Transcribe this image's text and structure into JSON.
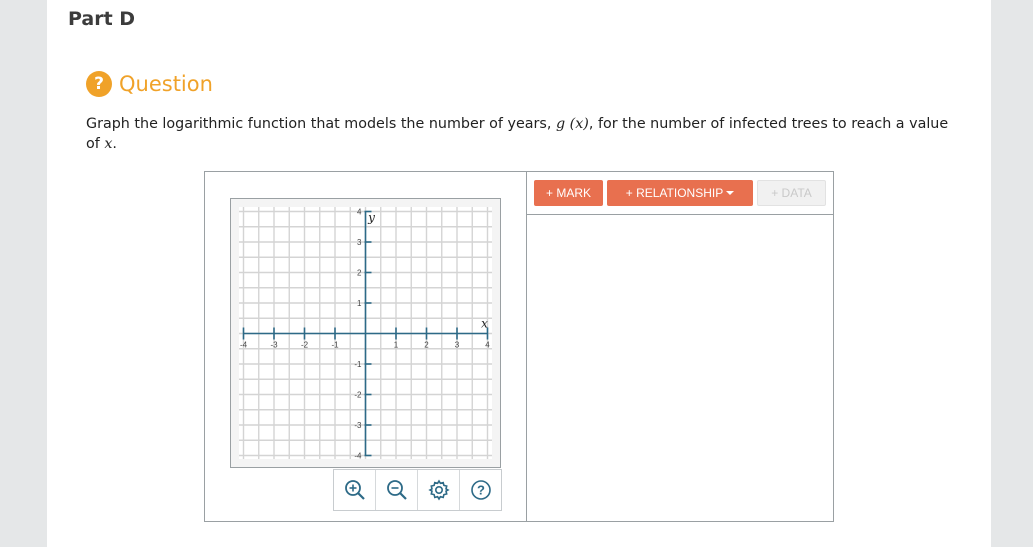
{
  "part_title": "Part D",
  "question": {
    "icon": "?",
    "label": "Question",
    "prompt_before": "Graph the logarithmic function that models the number of years,",
    "prompt_func": "g (x)",
    "prompt_after": ", for the number of infected trees to reach a value of",
    "prompt_var": "x",
    "prompt_end": "."
  },
  "toolbar": {
    "mark_label": "+ MARK",
    "relationship_label": "+ RELATIONSHIP",
    "data_label": "+ DATA"
  },
  "graph": {
    "x_axis_label": "x",
    "y_axis_label": "y",
    "xlim": [
      -4,
      4
    ],
    "ylim": [
      -4,
      4
    ],
    "x_ticks": [
      "-4",
      "-3",
      "-2",
      "-1",
      "1",
      "2",
      "3",
      "4"
    ],
    "y_ticks": [
      "4",
      "3",
      "2",
      "1",
      "-1",
      "-2",
      "-3",
      "-4"
    ]
  },
  "colors": {
    "accent_orange": "#f0a229",
    "button_orange": "#e8704f",
    "axis_blue": "#2d6a87"
  },
  "controls": {
    "zoom_in": "zoom-in-icon",
    "zoom_out": "zoom-out-icon",
    "settings": "gear-icon",
    "help": "help-icon"
  }
}
